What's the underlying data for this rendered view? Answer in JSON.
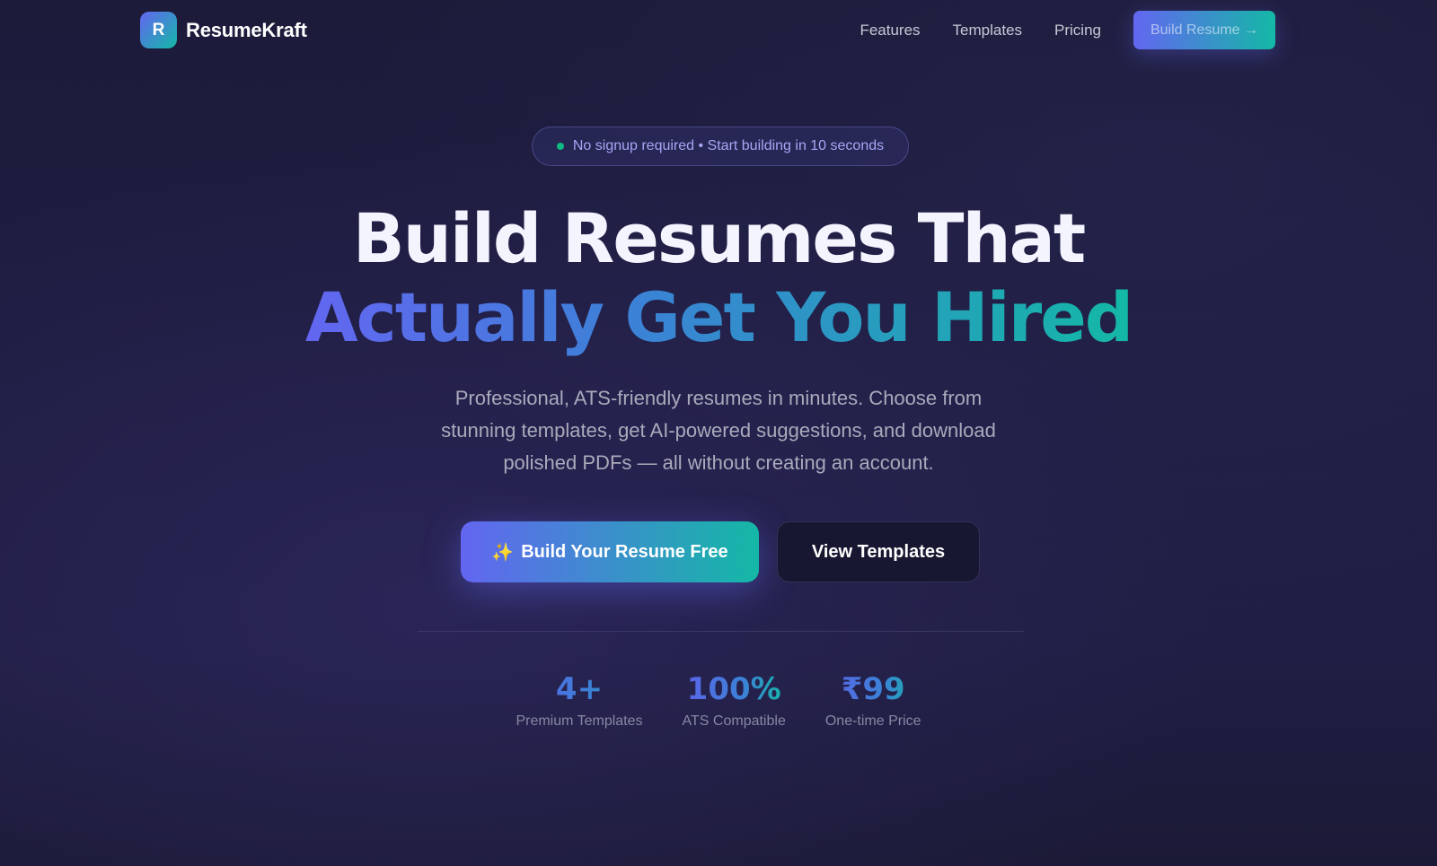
{
  "nav": {
    "logo_letter": "R",
    "brand": "ResumeKraft",
    "links": [
      "Features",
      "Templates",
      "Pricing"
    ],
    "cta": "Build Resume →"
  },
  "hero": {
    "badge": "No signup required • Start building in 10 seconds",
    "headline_line1": "Build Resumes That",
    "headline_line2": "Actually Get You Hired",
    "subtext": "Professional, ATS-friendly resumes in minutes. Choose from stunning templates, get AI-powered suggestions, and download polished PDFs — all without creating an account.",
    "primary_icon": "✨",
    "primary_button": "Build Your Resume Free",
    "secondary_button": "View Templates"
  },
  "stats": [
    {
      "value": "4+",
      "label": "Premium Templates"
    },
    {
      "value": "100%",
      "label": "ATS Compatible"
    },
    {
      "value": "₹99",
      "label": "One-time Price"
    }
  ],
  "colors": {
    "accent_start": "#6366f1",
    "accent_end": "#14b8a6",
    "badge_dot": "#10b981",
    "background": "#1f1d42"
  }
}
